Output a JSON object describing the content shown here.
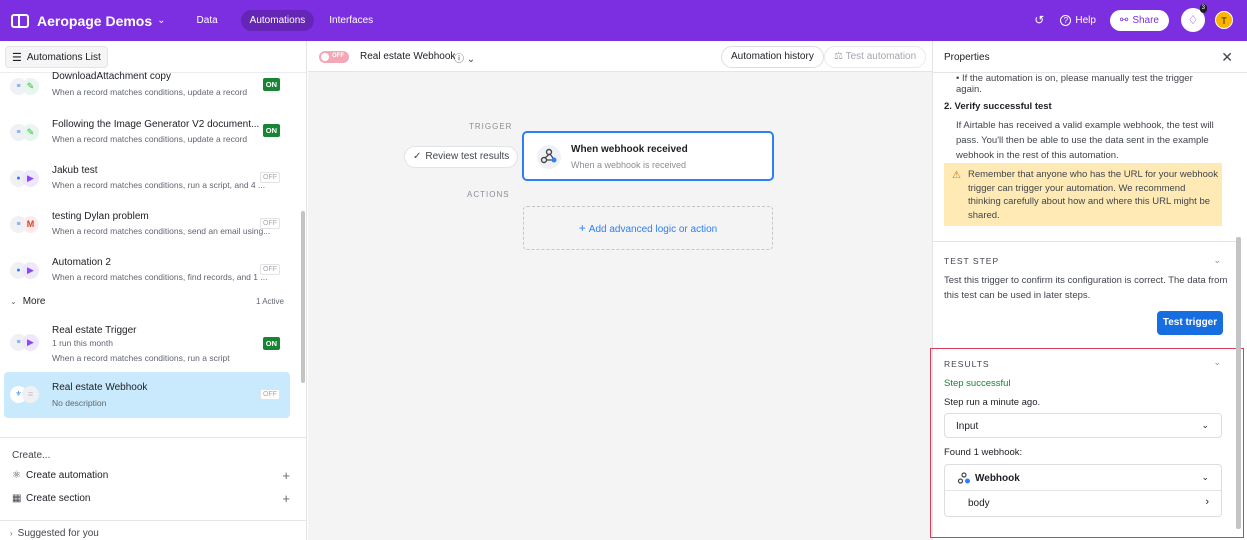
{
  "topbar": {
    "base_name": "Aeropage Demos",
    "nav": [
      "Data",
      "Automations",
      "Interfaces"
    ],
    "help": "Help",
    "share": "Share",
    "notif_count": "3",
    "avatar_initial": "T",
    "color_brand": "#7c2fe0"
  },
  "sidebar": {
    "list_label": "Automations List",
    "automations": [
      {
        "title": "DownloadAttachment copy",
        "desc": "When a record matches conditions, update a record",
        "status": "ON",
        "icon": "pencil-icon"
      },
      {
        "title": "Following the Image Generator V2 document...",
        "desc": "When a record matches conditions, update a record",
        "status": "ON",
        "icon": "pencil-icon"
      },
      {
        "title": "Jakub test",
        "desc": "When a record matches conditions, run a script, and 4 ...",
        "status": "OFF",
        "icon": "play-icon"
      },
      {
        "title": "testing Dylan problem",
        "desc": "When a record matches conditions, send an email using...",
        "status": "OFF",
        "icon": "gmail-icon"
      },
      {
        "title": "Automation 2",
        "desc": "When a record matches conditions, find records, and 1 ...",
        "status": "OFF",
        "icon": "play-icon"
      }
    ],
    "more_label": "More",
    "more_active": "1 Active",
    "more_items": [
      {
        "title": "Real estate Trigger",
        "sub": "1 run this month",
        "desc": "When a record matches conditions, run a script",
        "status": "ON",
        "icon": "play-icon"
      },
      {
        "title": "Real estate Webhook",
        "desc": "No description",
        "status": "OFF",
        "icon": "webhook-icon"
      }
    ],
    "create_label": "Create...",
    "create_automation": "Create automation",
    "create_section": "Create section",
    "suggested": "Suggested for you"
  },
  "canvas_bar": {
    "toggle_label": "OFF",
    "title": "Real estate Webhook",
    "history": "Automation history",
    "test": "Test automation"
  },
  "canvas": {
    "trigger_label": "TRIGGER",
    "actions_label": "ACTIONS",
    "review": "Review test results",
    "trigger_title": "When webhook received",
    "trigger_sub": "When a webhook is received",
    "add_action": "Add advanced logic or action"
  },
  "props": {
    "title": "Properties",
    "bullet_text": "If the automation is on, please manually test the trigger",
    "bullet_text2": "again.",
    "step2_title": "2. Verify successful test",
    "step2_text": "If Airtable has received a valid example webhook, the test will pass. You'll then be able to use the data sent in the example webhook in the rest of this automation.",
    "warning": "Remember that anyone who has the URL for your webhook trigger can trigger your automation. We recommend thinking carefully about how and where this URL might be shared.",
    "test_step_head": "TEST STEP",
    "test_step_text": "Test this trigger to confirm its configuration is correct. The data from this test can be used in later steps.",
    "test_trigger_btn": "Test trigger",
    "results_head": "RESULTS",
    "success": "Step successful",
    "ran": "Step run a minute ago.",
    "input_label": "Input",
    "found": "Found 1 webhook:",
    "webhook_label": "Webhook",
    "body_label": "body"
  }
}
